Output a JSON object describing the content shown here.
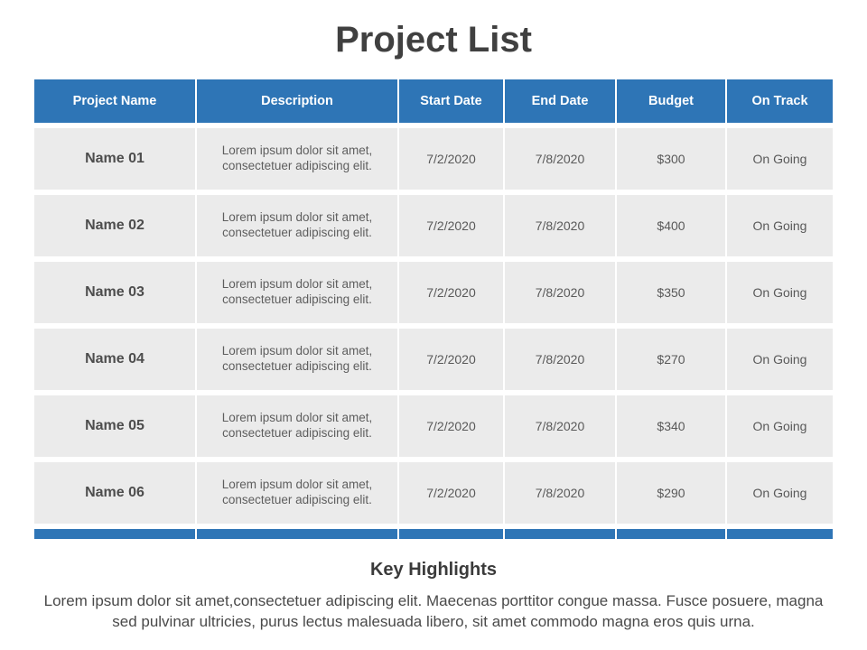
{
  "slide": {
    "title": "Project List"
  },
  "table": {
    "columns": [
      {
        "key": "name",
        "label": "Project Name"
      },
      {
        "key": "desc",
        "label": "Description"
      },
      {
        "key": "start",
        "label": "Start Date"
      },
      {
        "key": "end",
        "label": "End Date"
      },
      {
        "key": "budget",
        "label": "Budget"
      },
      {
        "key": "track",
        "label": "On Track"
      }
    ],
    "header_bg": "#2e75b6",
    "row_bg": "#ebebeb",
    "footer_bg": "#2e75b6",
    "rows": [
      {
        "name": "Name 01",
        "desc": "Lorem ipsum dolor sit amet, consectetuer adipiscing elit.",
        "start": "7/2/2020",
        "end": "7/8/2020",
        "budget": "$300",
        "track": "On Going"
      },
      {
        "name": "Name 02",
        "desc": "Lorem ipsum dolor sit amet, consectetuer adipiscing elit.",
        "start": "7/2/2020",
        "end": "7/8/2020",
        "budget": "$400",
        "track": "On Going"
      },
      {
        "name": "Name 03",
        "desc": "Lorem ipsum dolor sit amet, consectetuer adipiscing elit.",
        "start": "7/2/2020",
        "end": "7/8/2020",
        "budget": "$350",
        "track": "On Going"
      },
      {
        "name": "Name 04",
        "desc": "Lorem ipsum dolor sit amet, consectetuer adipiscing elit.",
        "start": "7/2/2020",
        "end": "7/8/2020",
        "budget": "$270",
        "track": "On Going"
      },
      {
        "name": "Name 05",
        "desc": "Lorem ipsum dolor sit amet, consectetuer adipiscing elit.",
        "start": "7/2/2020",
        "end": "7/8/2020",
        "budget": "$340",
        "track": "On Going"
      },
      {
        "name": "Name 06",
        "desc": "Lorem ipsum dolor sit amet, consectetuer adipiscing elit.",
        "start": "7/2/2020",
        "end": "7/8/2020",
        "budget": "$290",
        "track": "On Going"
      }
    ]
  },
  "highlights": {
    "title": "Key Highlights",
    "body": "Lorem ipsum dolor sit amet,consectetuer adipiscing elit. Maecenas porttitor congue massa. Fusce posuere, magna sed pulvinar ultricies, purus lectus malesuada libero, sit amet commodo magna eros quis urna."
  }
}
